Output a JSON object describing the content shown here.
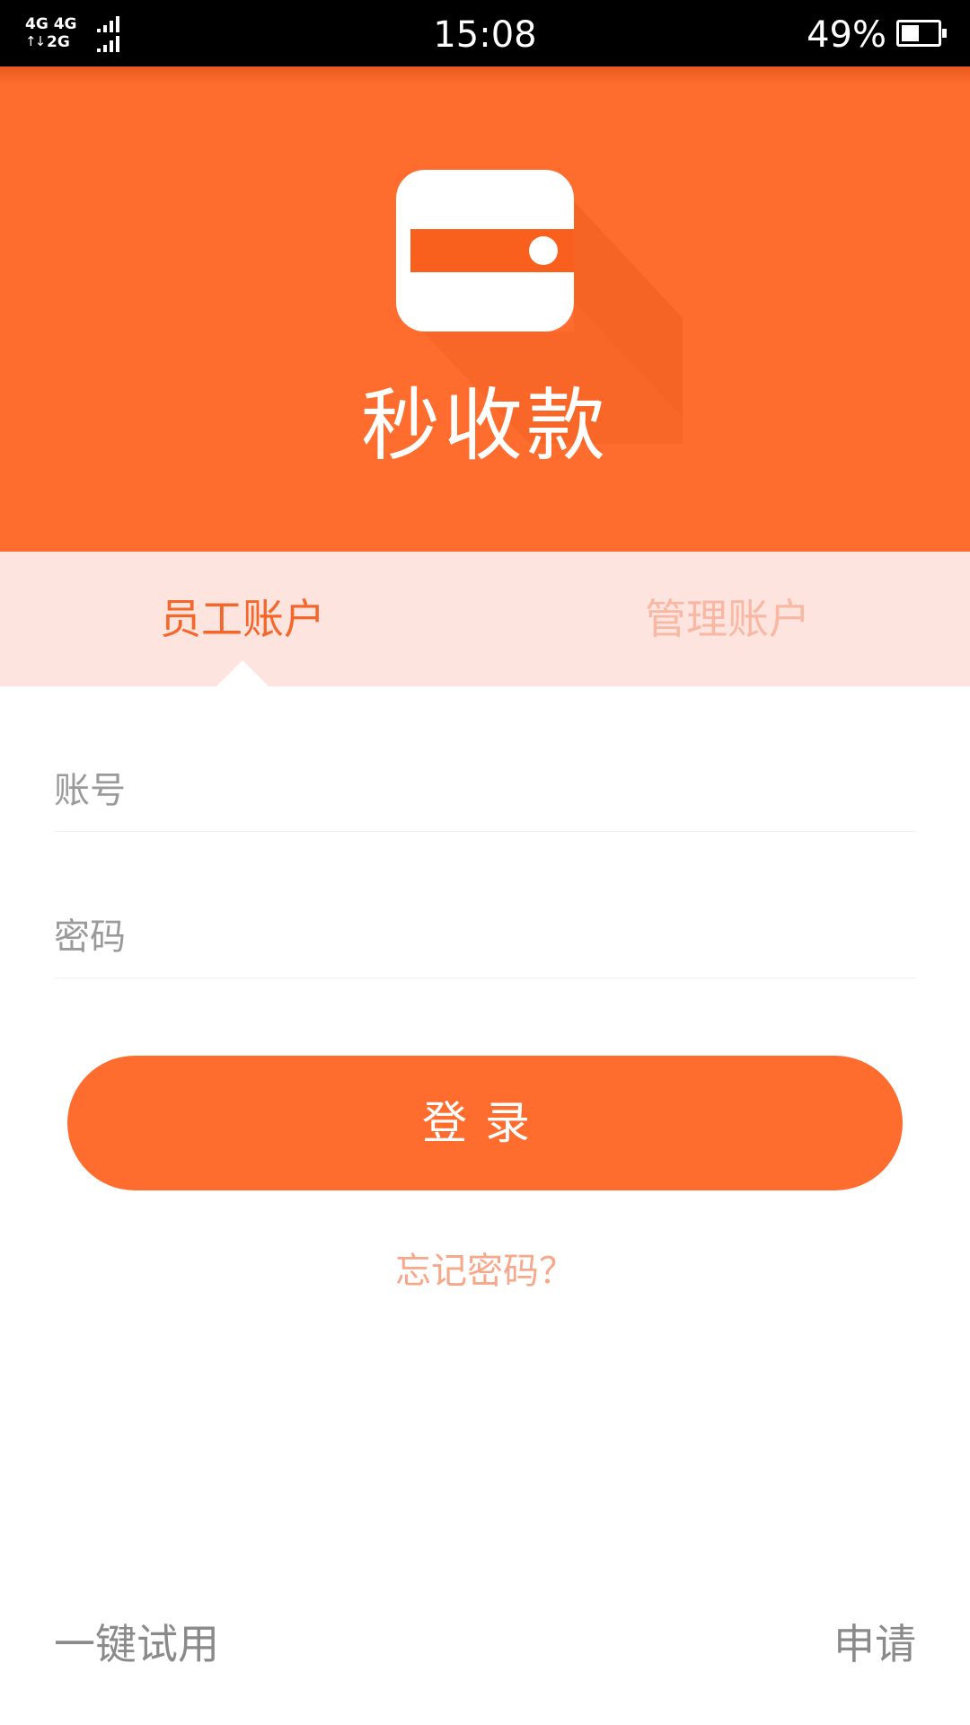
{
  "status_bar": {
    "network_line1": "4G 4G",
    "network_line2": "2G",
    "arrows": "↑↓",
    "time": "15:08",
    "battery_percent": "49%",
    "battery_level": 0.49
  },
  "app": {
    "logo_icon": "wallet-icon",
    "title": "秒收款",
    "brand_color": "#ff6d2e"
  },
  "tabs": {
    "employee": "员工账户",
    "admin": "管理账户",
    "selected": "employee"
  },
  "form": {
    "account_placeholder": "账号",
    "account_value": "",
    "password_placeholder": "密码",
    "password_value": "",
    "login_label": "登录",
    "forgot_label": "忘记密码？"
  },
  "footer": {
    "trial_label": "一键试用",
    "apply_label": "申请"
  }
}
